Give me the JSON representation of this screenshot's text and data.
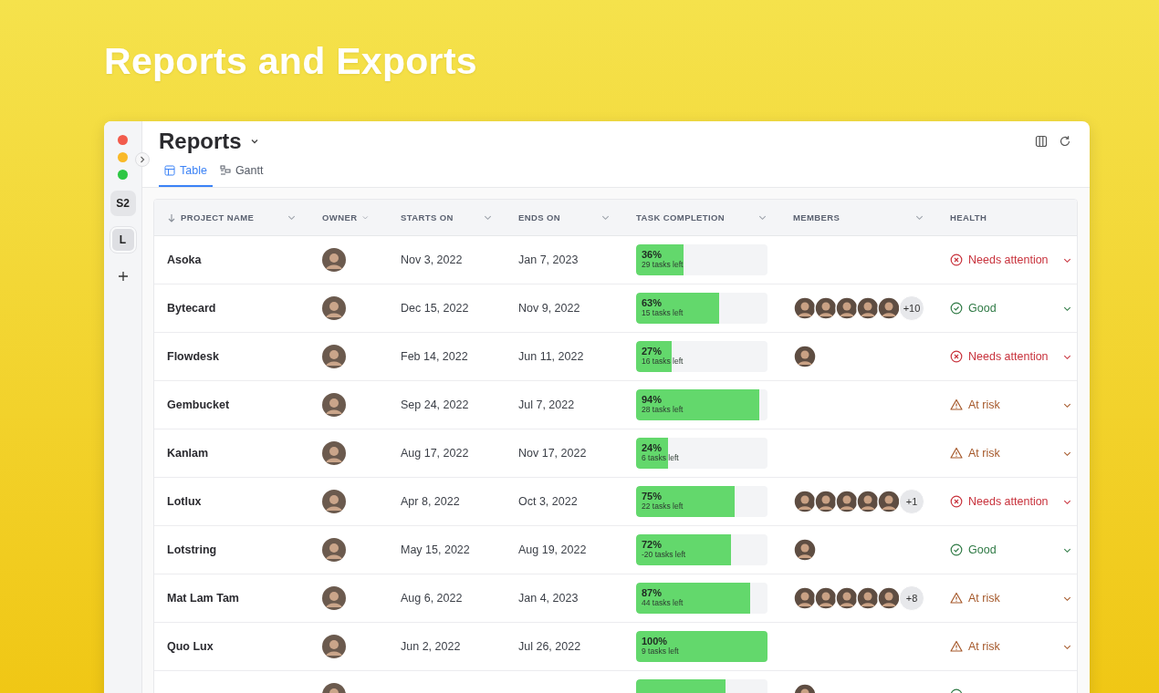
{
  "headline": "Reports and Exports",
  "window": {
    "title": "Reports",
    "tabs": [
      {
        "label": "Table",
        "kind": "table",
        "selected": true
      },
      {
        "label": "Gantt",
        "kind": "gantt",
        "selected": false
      }
    ]
  },
  "sidebar": {
    "items": [
      {
        "label": "S2",
        "selected": false
      },
      {
        "label": "L",
        "selected": true
      }
    ]
  },
  "table": {
    "columns": [
      {
        "label": "PROJECT NAME",
        "sort": true,
        "menu": true
      },
      {
        "label": "OWNER",
        "sort": false,
        "menu": true
      },
      {
        "label": "STARTS ON",
        "sort": false,
        "menu": true
      },
      {
        "label": "ENDS ON",
        "sort": false,
        "menu": true
      },
      {
        "label": "TASK COMPLETION",
        "sort": false,
        "menu": true
      },
      {
        "label": "MEMBERS",
        "sort": false,
        "menu": true
      },
      {
        "label": "HEALTH",
        "sort": false,
        "menu": false
      }
    ],
    "rows": [
      {
        "name": "Asoka",
        "starts": "Nov 3, 2022",
        "ends": "Jan 7, 2023",
        "percent": "36%",
        "left": "29 tasks left",
        "level": 0.36,
        "kind": "attention",
        "health_label": "Needs attention"
      },
      {
        "name": "Bytecard",
        "starts": "Dec 15, 2022",
        "ends": "Nov 9, 2022",
        "percent": "63%",
        "left": "15 tasks left",
        "level": 0.63,
        "members": [
          {
            "kind": "avatar"
          },
          {
            "kind": "avatar"
          },
          {
            "kind": "avatar"
          },
          {
            "kind": "avatar"
          },
          {
            "kind": "avatar"
          }
        ],
        "more": "+10",
        "kind": "good",
        "health_label": "Good"
      },
      {
        "name": "Flowdesk",
        "starts": "Feb 14, 2022",
        "ends": "Jun 11, 2022",
        "percent": "27%",
        "left": "16 tasks left",
        "level": 0.27,
        "members": [
          {
            "kind": "avatar"
          }
        ],
        "kind": "attention",
        "health_label": "Needs attention"
      },
      {
        "name": "Gembucket",
        "starts": "Sep 24, 2022",
        "ends": "Jul 7, 2022",
        "percent": "94%",
        "left": "28 tasks left",
        "level": 0.94,
        "kind": "risk",
        "health_label": "At risk"
      },
      {
        "name": "Kanlam",
        "starts": "Aug 17, 2022",
        "ends": "Nov 17, 2022",
        "percent": "24%",
        "left": "6 tasks left",
        "level": 0.24,
        "kind": "risk",
        "health_label": "At risk"
      },
      {
        "name": "Lotlux",
        "starts": "Apr 8, 2022",
        "ends": "Oct 3, 2022",
        "percent": "75%",
        "left": "22 tasks left",
        "level": 0.75,
        "members": [
          {
            "kind": "avatar"
          },
          {
            "kind": "avatar"
          },
          {
            "kind": "avatar"
          },
          {
            "kind": "avatar"
          },
          {
            "kind": "avatar"
          }
        ],
        "more": "+1",
        "kind": "attention",
        "health_label": "Needs attention"
      },
      {
        "name": "Lotstring",
        "starts": "May 15, 2022",
        "ends": "Aug 19, 2022",
        "percent": "72%",
        "left": "-20 tasks left",
        "level": 0.72,
        "members": [
          {
            "kind": "avatar"
          }
        ],
        "kind": "good",
        "health_label": "Good"
      },
      {
        "name": "Mat Lam Tam",
        "starts": "Aug 6, 2022",
        "ends": "Jan 4, 2023",
        "percent": "87%",
        "left": "44 tasks left",
        "level": 0.87,
        "members": [
          {
            "kind": "avatar"
          },
          {
            "kind": "avatar"
          },
          {
            "kind": "avatar"
          },
          {
            "kind": "avatar"
          },
          {
            "kind": "avatar"
          }
        ],
        "more": "+8",
        "kind": "risk",
        "health_label": "At risk"
      },
      {
        "name": "Quo Lux",
        "starts": "Jun 2, 2022",
        "ends": "Jul 26, 2022",
        "percent": "100%",
        "left": "9 tasks left",
        "level": 1.0,
        "kind": "risk",
        "health_label": "At risk"
      },
      {
        "level": 0.68,
        "members": [
          {
            "kind": "avatar"
          }
        ],
        "kind": "good"
      }
    ]
  }
}
